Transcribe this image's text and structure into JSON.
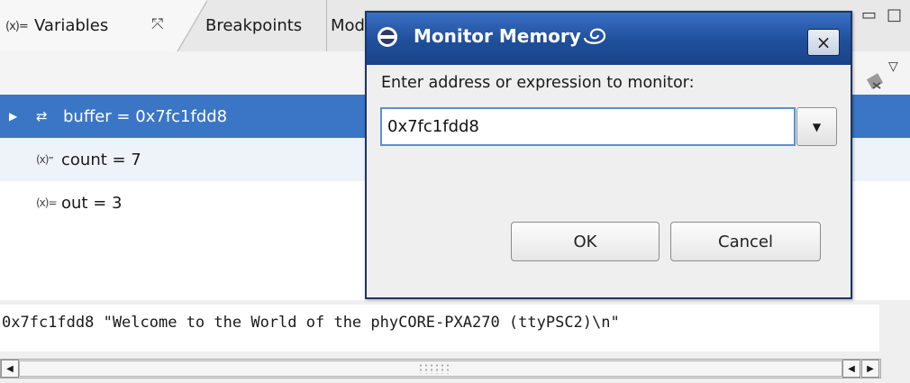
{
  "view": {
    "tabs": [
      {
        "label": "Variables",
        "icon": "variables-icon",
        "active": true
      },
      {
        "label": "Breakpoints",
        "active": false
      },
      {
        "label": "Mod",
        "active": false
      }
    ],
    "variables": [
      {
        "icon": "pointer-variable-icon",
        "label": "buffer = 0x7fc1fdd8",
        "expandable": true,
        "selected": true
      },
      {
        "icon": "variable-icon",
        "label": "count = 7",
        "expandable": false,
        "selected": false
      },
      {
        "icon": "variable-icon",
        "label": "out = 3",
        "expandable": false,
        "selected": false
      }
    ],
    "detail_text": "0x7fc1fdd8 \"Welcome to the World of the phyCORE-PXA270  (ttyPSC2)\\n\""
  },
  "dialog": {
    "title": "Monitor Memory",
    "prompt": "Enter address or expression to monitor:",
    "input_value": "0x7fc1fdd8",
    "ok_label": "OK",
    "cancel_label": "Cancel"
  },
  "colors": {
    "selection": "#3b76c6",
    "titlebar": "#1f4f9a"
  }
}
